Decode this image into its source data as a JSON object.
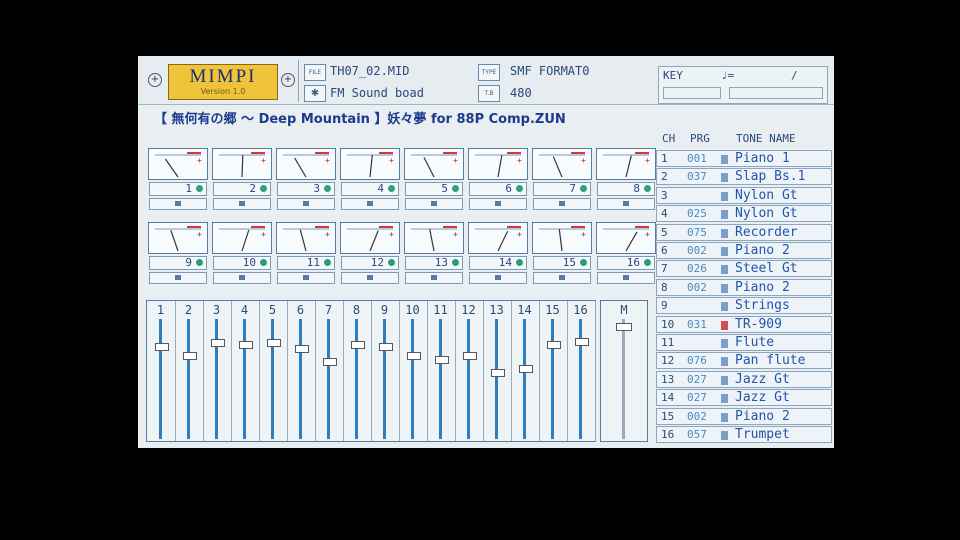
{
  "app": {
    "logo": "MIMPI",
    "version": "Version 1.0"
  },
  "file": {
    "tag": "FILE",
    "name": "TH07_02.MID",
    "type_tag": "TYPE",
    "type": "SMF FORMAT0",
    "device": "FM Sound boad",
    "tempo_tag": "T.B",
    "tempo": "480"
  },
  "key": {
    "label": "KEY",
    "note_symbol": "♩=",
    "slash": "/"
  },
  "title": "【 無何有の郷  ～ Deep Mountain 】妖々夢 for 88P Comp.ZUN",
  "table": {
    "headers": {
      "ch": "CH",
      "prg": "PRG",
      "tone": "TONE NAME"
    },
    "rows": [
      {
        "ch": "1",
        "prg": "001",
        "name": "Piano 1"
      },
      {
        "ch": "2",
        "prg": "037",
        "name": "Slap Bs.1"
      },
      {
        "ch": "3",
        "prg": "",
        "name": "Nylon Gt"
      },
      {
        "ch": "4",
        "prg": "025",
        "name": "Nylon Gt"
      },
      {
        "ch": "5",
        "prg": "075",
        "name": "Recorder"
      },
      {
        "ch": "6",
        "prg": "002",
        "name": "Piano 2"
      },
      {
        "ch": "7",
        "prg": "026",
        "name": "Steel Gt"
      },
      {
        "ch": "8",
        "prg": "002",
        "name": "Piano 2"
      },
      {
        "ch": "9",
        "prg": "",
        "name": "Strings"
      },
      {
        "ch": "10",
        "prg": "031",
        "name": "TR-909"
      },
      {
        "ch": "11",
        "prg": "",
        "name": "Flute"
      },
      {
        "ch": "12",
        "prg": "076",
        "name": "Pan flute"
      },
      {
        "ch": "13",
        "prg": "027",
        "name": "Jazz Gt"
      },
      {
        "ch": "14",
        "prg": "027",
        "name": "Jazz Gt"
      },
      {
        "ch": "15",
        "prg": "002",
        "name": "Piano 2"
      },
      {
        "ch": "16",
        "prg": "057",
        "name": "Trumpet"
      }
    ]
  },
  "modules": [
    "1",
    "2",
    "3",
    "4",
    "5",
    "6",
    "7",
    "8",
    "9",
    "10",
    "11",
    "12",
    "13",
    "14",
    "15",
    "16"
  ],
  "fader_labels": [
    "1",
    "2",
    "3",
    "4",
    "5",
    "6",
    "7",
    "8",
    "9",
    "10",
    "11",
    "12",
    "13",
    "14",
    "15",
    "16"
  ],
  "fader_levels": [
    0.78,
    0.7,
    0.82,
    0.8,
    0.82,
    0.76,
    0.65,
    0.8,
    0.78,
    0.7,
    0.66,
    0.7,
    0.55,
    0.58,
    0.8,
    0.83
  ],
  "master_label": "M",
  "colors": {
    "accent": "#2b7fc0",
    "text": "#2a4a7a",
    "logo": "#f0c43a"
  }
}
